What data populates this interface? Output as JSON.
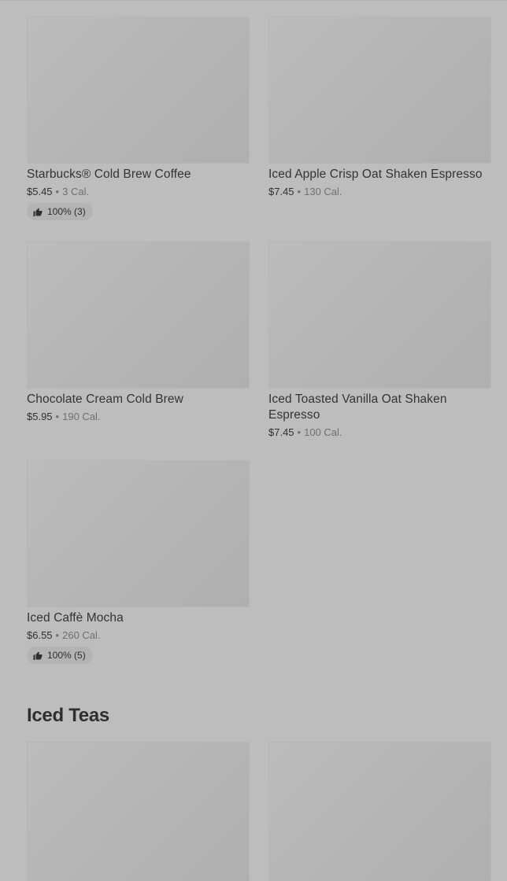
{
  "products": [
    {
      "name": "Starbucks® Cold Brew Coffee",
      "price": "$5.45",
      "calories": "3 Cal.",
      "rating": "100% (3)"
    },
    {
      "name": "Iced Apple Crisp Oat Shaken Espresso",
      "price": "$7.45",
      "calories": "130 Cal."
    },
    {
      "name": "Chocolate Cream Cold Brew",
      "price": "$5.95",
      "calories": "190 Cal."
    },
    {
      "name": "Iced Toasted Vanilla Oat Shaken Espresso",
      "price": "$7.45",
      "calories": "100 Cal."
    },
    {
      "name": "Iced Caffè Mocha",
      "price": "$6.55",
      "calories": "260 Cal.",
      "rating": "100% (5)"
    }
  ],
  "meta_separator": "•",
  "sections": {
    "iced_teas_title": "Iced Teas"
  },
  "colors": {
    "background": "#bdbdbd",
    "card_placeholder": "#b5b5b5",
    "text_primary": "#333333",
    "text_secondary": "#707070"
  }
}
